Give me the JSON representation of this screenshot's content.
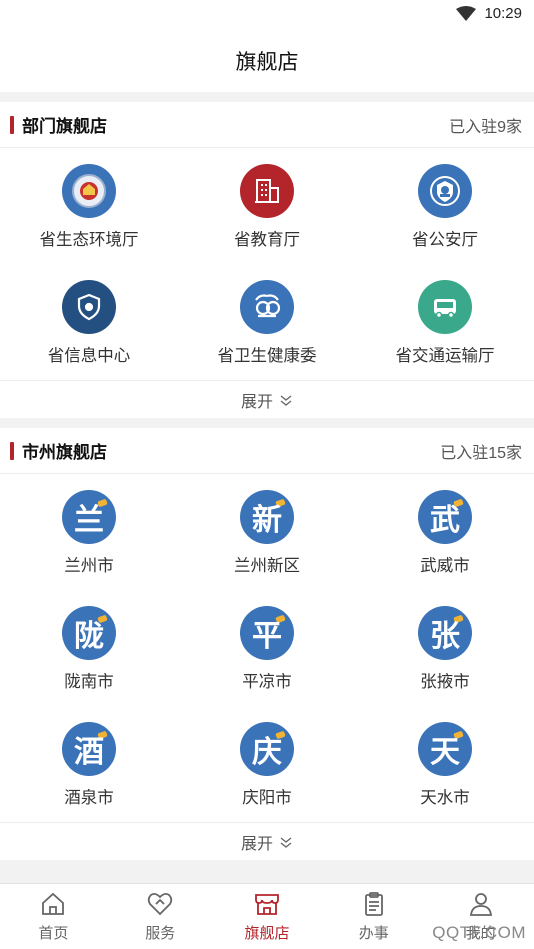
{
  "status_bar": {
    "time": "10:29"
  },
  "header": {
    "title": "旗舰店"
  },
  "departments": {
    "title": "部门旗舰店",
    "count": "已入驻9家",
    "items": [
      {
        "label": "省生态环境厅",
        "icon": "emblem-icon",
        "color": "#3a73b8"
      },
      {
        "label": "省教育厅",
        "icon": "building-icon",
        "color": "#b3252b"
      },
      {
        "label": "省公安厅",
        "icon": "police-badge-icon",
        "color": "#3a73b8"
      },
      {
        "label": "省信息中心",
        "icon": "shield-icon",
        "color": "#245081"
      },
      {
        "label": "省卫生健康委",
        "icon": "health-logo-icon",
        "color": "#3a73b8"
      },
      {
        "label": "省交通运输厅",
        "icon": "vehicle-icon",
        "color": "#3aa88a"
      }
    ],
    "expand_label": "展开"
  },
  "cities": {
    "title": "市州旗舰店",
    "count": "已入驻15家",
    "items": [
      {
        "label": "兰州市",
        "glyph": "兰"
      },
      {
        "label": "兰州新区",
        "glyph": "新"
      },
      {
        "label": "武威市",
        "glyph": "武"
      },
      {
        "label": "陇南市",
        "glyph": "陇"
      },
      {
        "label": "平凉市",
        "glyph": "平"
      },
      {
        "label": "张掖市",
        "glyph": "张"
      },
      {
        "label": "酒泉市",
        "glyph": "酒"
      },
      {
        "label": "庆阳市",
        "glyph": "庆"
      },
      {
        "label": "天水市",
        "glyph": "天"
      }
    ],
    "expand_label": "展开",
    "color": "#3a73b8"
  },
  "tabbar": {
    "tabs": [
      {
        "label": "首页",
        "icon": "home-icon"
      },
      {
        "label": "服务",
        "icon": "heart-tag-icon"
      },
      {
        "label": "旗舰店",
        "icon": "store-icon",
        "active": true
      },
      {
        "label": "办事",
        "icon": "clipboard-icon"
      },
      {
        "label": "我的",
        "icon": "user-icon"
      }
    ]
  },
  "watermark": "QQTF.COM",
  "colors": {
    "accent": "#b3252b",
    "city_blue": "#3a73b8"
  }
}
